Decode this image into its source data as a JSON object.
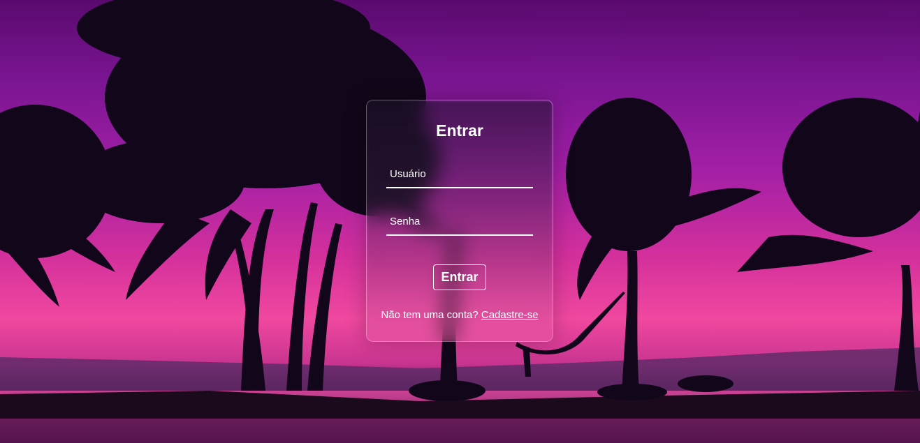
{
  "login": {
    "title": "Entrar",
    "username_placeholder": "Usuário",
    "password_placeholder": "Senha",
    "submit_label": "Entrar",
    "signup_prompt": "Não tem uma conta?",
    "signup_link": "Cadastre-se"
  },
  "background": {
    "scene": "sunset-palm-beach",
    "colors": {
      "sky_top": "#5a0a6e",
      "sky_mid": "#a21fa6",
      "horizon": "#f0489f",
      "silhouette": "#12061a"
    }
  }
}
